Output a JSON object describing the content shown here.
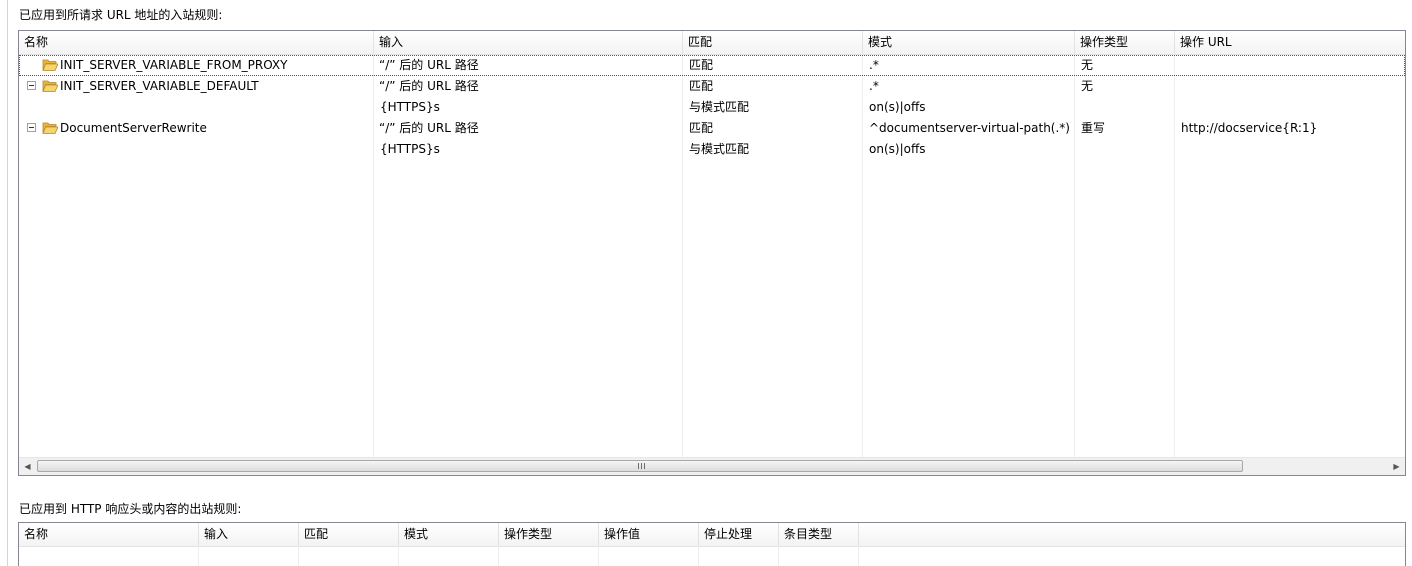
{
  "inbound": {
    "title": "已应用到所请求 URL 地址的入站规则:",
    "columns": [
      "名称",
      "输入",
      "匹配",
      "模式",
      "操作类型",
      "操作 URL"
    ],
    "rows": [
      {
        "name": "INIT_SERVER_VARIABLE_FROM_PROXY",
        "input": "“/” 后的 URL 路径",
        "match": "匹配",
        "pattern": ".*",
        "action_type": "无",
        "action_url": ""
      },
      {
        "name": "INIT_SERVER_VARIABLE_DEFAULT",
        "input": "“/” 后的 URL 路径",
        "match": "匹配",
        "pattern": ".*",
        "action_type": "无",
        "action_url": ""
      },
      {
        "name": "",
        "input": "{HTTPS}s",
        "match": "与模式匹配",
        "pattern": "on(s)|offs",
        "action_type": "",
        "action_url": ""
      },
      {
        "name": "DocumentServerRewrite",
        "input": "“/” 后的 URL 路径",
        "match": "匹配",
        "pattern": "^documentserver-virtual-path(.*)",
        "action_type": "重写",
        "action_url": "http://docservice{R:1}"
      },
      {
        "name": "",
        "input": "{HTTPS}s",
        "match": "与模式匹配",
        "pattern": "on(s)|offs",
        "action_type": "",
        "action_url": ""
      }
    ],
    "scrollbar": {
      "left_arrow": "◀",
      "right_arrow": "▶"
    }
  },
  "outbound": {
    "title": "已应用到 HTTP 响应头或内容的出站规则:",
    "columns": [
      "名称",
      "输入",
      "匹配",
      "模式",
      "操作类型",
      "操作值",
      "停止处理",
      "条目类型"
    ]
  },
  "icons": {
    "folder": "folder-open-icon",
    "collapse": "collapse-minus-icon"
  },
  "colors": {
    "border": "#828790",
    "folder": "#f0c24a",
    "selection_outline": "#555555"
  }
}
